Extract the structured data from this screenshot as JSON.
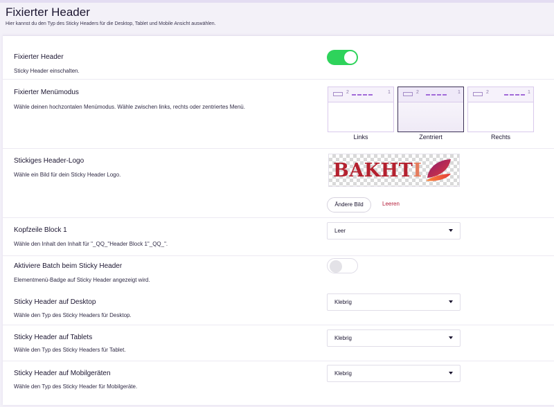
{
  "page": {
    "title": "Fixierter Header",
    "subtitle": "Hier kannst du den Typ des Sticky Headers für die Desktop, Tablet und Mobile Ansicht auswählen."
  },
  "sticky_header": {
    "label": "Fixierter Header",
    "desc": "Sticky Header einschalten.",
    "enabled": true
  },
  "menu_mode": {
    "label": "Fixierter Menümodus",
    "desc": "Wähle deinen hochzontalen Menümodus. Wähle zwischen links, rechts oder zentriertes Menü.",
    "options": [
      {
        "label": "Links",
        "left_num": "2",
        "right_num": "1"
      },
      {
        "label": "Zentriert",
        "left_num": "2",
        "right_num": "1"
      },
      {
        "label": "Rechts",
        "left_num": "2",
        "right_num": "1"
      }
    ],
    "selected": "Zentriert"
  },
  "logo": {
    "label": "Stickiges Header-Logo",
    "desc": "Wähle ein Bild für dein Sticky Header Logo.",
    "image_text_main": "BAKHT",
    "image_text_fade": "I",
    "change_button": "Ändere Bild",
    "clear_button": "Leeren"
  },
  "block1": {
    "label": "Kopfzeile Block 1",
    "desc": "Wähle den Inhalt den Inhalt für \"_QQ_\"Header Block 1\"_QQ_\".",
    "value": "Leer"
  },
  "batch": {
    "label": "Aktiviere Batch beim Sticky Header",
    "desc": "Elementmenü-Badge auf Sticky Header angezeigt wird.",
    "enabled": false
  },
  "desktop": {
    "label": "Sticky Header auf Desktop",
    "desc": "Wähle den Typ des Sticky Headers für Desktop.",
    "value": "Klebrig"
  },
  "tablets": {
    "label": "Sticky Header auf Tablets",
    "desc": "Wähle den Typ des Sticky Headers für Tablet.",
    "value": "Klebrig"
  },
  "mobile": {
    "label": "Sticky Header auf Mobilgeräten",
    "desc": "Wähle den Typ des Sticky Header für Mobilgeräte.",
    "value": "Klebrig"
  },
  "colors": {
    "toggle_on": "#2ed35b",
    "accent_purple": "#a16ad8",
    "link_red": "#b51e3a"
  }
}
